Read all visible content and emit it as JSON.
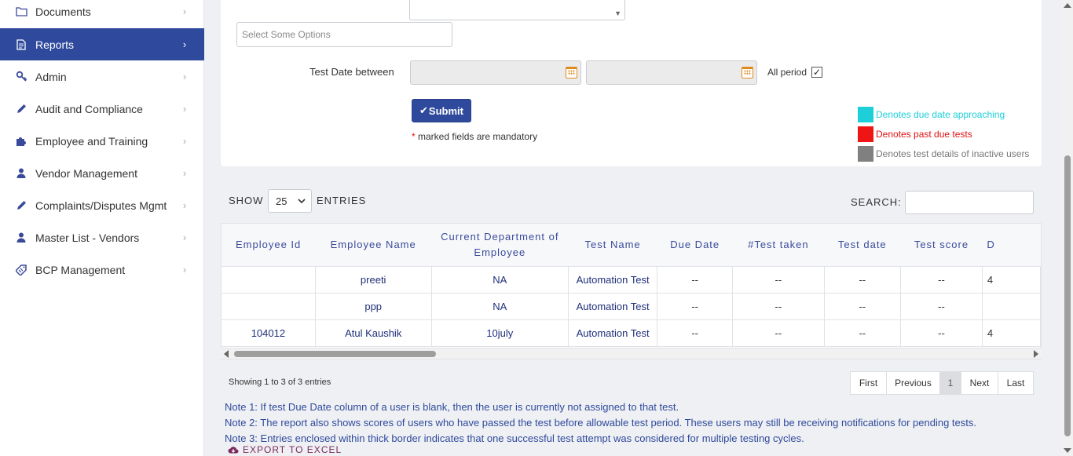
{
  "sidebar": {
    "items": [
      {
        "label": "Documents",
        "icon": "folder-icon",
        "active": false
      },
      {
        "label": "Reports",
        "icon": "document-icon",
        "active": true
      },
      {
        "label": "Admin",
        "icon": "key-icon",
        "active": false
      },
      {
        "label": "Audit and Compliance",
        "icon": "pencil-icon",
        "active": false
      },
      {
        "label": "Employee and Training",
        "icon": "puzzle-icon",
        "active": false
      },
      {
        "label": "Vendor Management",
        "icon": "user-icon",
        "active": false
      },
      {
        "label": "Complaints/Disputes Mgmt",
        "icon": "pencil-icon",
        "active": false
      },
      {
        "label": "Master List - Vendors",
        "icon": "user-icon",
        "active": false
      },
      {
        "label": "BCP Management",
        "icon": "tag-icon",
        "active": false
      }
    ]
  },
  "filters": {
    "multiselect_placeholder": "Select Some Options",
    "test_date_label": "Test Date between",
    "date_from_value": "",
    "date_to_value": "",
    "all_period_label": "All period",
    "all_period_checked": true,
    "submit_label": "Submit",
    "mandatory_star": "*",
    "mandatory_note": "marked fields are mandatory"
  },
  "legend": [
    {
      "label": "Denotes due date approaching",
      "color": "#1ccfd9",
      "text_color": "#1ccfd9"
    },
    {
      "label": "Denotes past due tests",
      "color": "#f01515",
      "text_color": "#e01010"
    },
    {
      "label": "Denotes test details of inactive users",
      "color": "#808080",
      "text_color": "#777777"
    }
  ],
  "table_controls": {
    "show_label": "SHOW",
    "page_size": "25",
    "entries_label": "ENTRIES",
    "search_label": "SEARCH:",
    "search_value": ""
  },
  "table": {
    "columns": [
      "Employee Id",
      "Employee Name",
      "Current Department of Employee",
      "Test Name",
      "Due Date",
      "#Test taken",
      "Test date",
      "Test score",
      "D"
    ],
    "rows": [
      [
        "",
        "preeti",
        "NA",
        "Automation Test",
        "--",
        "--",
        "--",
        "--",
        "4"
      ],
      [
        "",
        "ppp",
        "NA",
        "Automation Test",
        "--",
        "--",
        "--",
        "--",
        ""
      ],
      [
        "104012",
        "Atul Kaushik",
        "10july",
        "Automation Test",
        "--",
        "--",
        "--",
        "--",
        "4"
      ]
    ]
  },
  "pagination": {
    "info": "Showing 1 to 3 of 3 entries",
    "first": "First",
    "previous": "Previous",
    "current": "1",
    "next": "Next",
    "last": "Last"
  },
  "notes": [
    "Note 1: If test Due Date column of a user is blank, then the user is currently not assigned to that test.",
    "Note 2: The report also shows scores of users who have passed the test before allowable test period. These users may still be receiving notifications for pending tests.",
    "Note 3: Entries enclosed within thick border indicates that one successful test attempt was considered for multiple testing cycles."
  ],
  "export_label": "EXPORT TO EXCEL",
  "colors": {
    "accent": "#2f4a9c",
    "link": "#1f2f7a"
  }
}
